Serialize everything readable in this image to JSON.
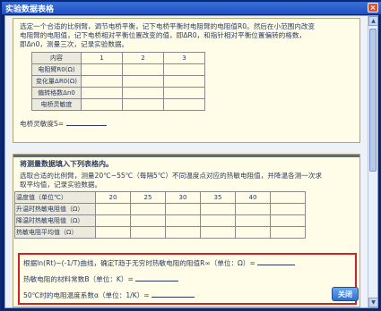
{
  "window": {
    "title": "实验数据表格",
    "close_glyph": "×"
  },
  "section1": {
    "instructions": [
      "选定一个合适的比例臂，调节电桥平衡，记下电桥平衡时电阻臂的电阻值R0。然后在小范围内改变",
      "电阻臂的电阻值，记下电桥相对平衡位置改变的值，即ΔR0，和指针相对平衡位置偏转的格数，",
      "即Δn0，测量三次，记录实验数据。"
    ],
    "table": {
      "headers": [
        "内容",
        "1",
        "2",
        "3"
      ],
      "rows": [
        {
          "label": "电阻臂R0(Ω)",
          "cells": [
            "",
            "",
            ""
          ]
        },
        {
          "label": "变化量ΔR0(Ω)",
          "cells": [
            "",
            "",
            ""
          ]
        },
        {
          "label": "偏转格数Δn0",
          "cells": [
            "",
            "",
            ""
          ]
        },
        {
          "label": "电桥灵敏度",
          "cells": [
            "",
            "",
            ""
          ]
        }
      ]
    },
    "sensitivity_label": "电桥灵敏度S="
  },
  "section2": {
    "heading": "将测量数据填入下列表格内。",
    "instructions": [
      "选取合适的比例臂，测量20℃~55℃（每隔5℃）不同温度点对应的热敏电阻值，并降温各测一次求",
      "取平均值，记录实验数据。"
    ],
    "table": {
      "header_label": "温度值（单位℃）",
      "temperatures": [
        "20",
        "25",
        "30",
        "35",
        "40",
        ""
      ],
      "rows": [
        {
          "label": "升温时热敏电阻值（Ω）",
          "cells": [
            "",
            "",
            "",
            "",
            "",
            ""
          ]
        },
        {
          "label": "降温时热敏电阻值（Ω）",
          "cells": [
            "",
            "",
            "",
            "",
            "",
            ""
          ]
        },
        {
          "label": "热敏电阻平均值（Ω）",
          "cells": [
            "",
            "",
            "",
            "",
            "",
            ""
          ]
        }
      ]
    },
    "results": {
      "line1": "根据ln(Rt)~(-1/T)曲线，确定T趋于无穷时热敏电阻的阻值R∞（单位：Ω）=",
      "line2": "热敏电阻的材料常数B（单位：K）=",
      "line3": "50℃时的电阻温度系数α（单位：1/K）="
    }
  },
  "close_button": "关闭",
  "colors": {
    "titlebar": "#1e50c4",
    "panel_bg": "#fffde8",
    "highlight_border": "#d62020",
    "button": "#2d6fd0"
  }
}
